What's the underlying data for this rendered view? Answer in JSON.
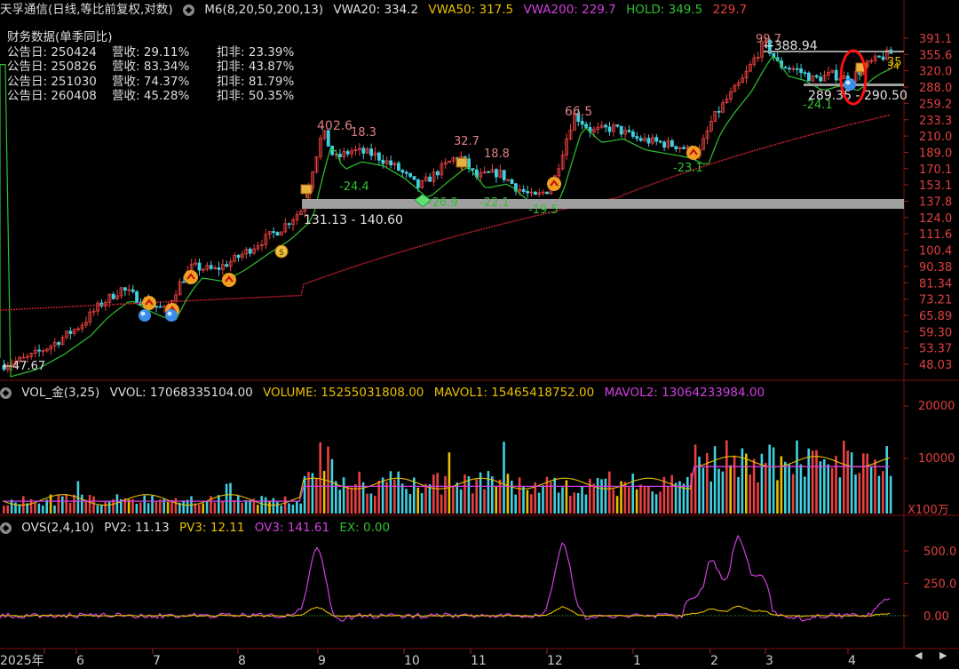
{
  "header": {
    "stock": "天孚通信(日线,等比前复权,对数)",
    "m6": "M6(8,20,50,200,13)",
    "vwa20": "VWA20: 334.2",
    "vwa50": "VWA50: 317.5",
    "vwa200": "VWA200: 229.7",
    "hold": "HOLD: 349.5",
    "hold2": "229.7"
  },
  "financials": {
    "title": "财务数据(单季同比)",
    "rows": [
      {
        "date": "公告日: 250424",
        "rev": "营收:  29.11%",
        "net": "扣非:  23.39%"
      },
      {
        "date": "公告日: 250826",
        "rev": "营收:  83.34%",
        "net": "扣非:  43.87%"
      },
      {
        "date": "公告日: 251030",
        "rev": "营收:  74.37%",
        "net": "扣非:  81.79%"
      },
      {
        "date": "公告日: 260408",
        "rev": "营收:  45.28%",
        "net": "扣非:  50.35%"
      }
    ]
  },
  "price_axis": [
    "391.1",
    "355.6",
    "320.0",
    "288.0",
    "259.2",
    "233.3",
    "210.0",
    "189.0",
    "170.1",
    "153.1",
    "137.8",
    "124.0",
    "111.6",
    "100.4",
    "90.38",
    "81.34",
    "73.21",
    "65.89",
    "59.30",
    "53.37",
    "48.03"
  ],
  "annotations": {
    "low_start": "47.67",
    "p402": "402.6",
    "p183": "18.3",
    "m244": "-24.4",
    "p327": "32.7",
    "p188": "18.8",
    "m269": "-26.9",
    "m221": "-22.1",
    "m195": "-19.5",
    "p665": "66.5",
    "m231": "-23.1",
    "p997": "99.7",
    "p38894": "388.94",
    "m241": "-24.1",
    "range1": "131.13 - 140.60",
    "range2": "289.35 - 290.50",
    "p35": "35",
    "p34": "34"
  },
  "vol_header": {
    "name": "VOL_金(3,25)",
    "vvol": "VVOL: 17068335104.00",
    "volume": "VOLUME: 15255031808.00",
    "mavol1": "MAVOL1: 15465418752.00",
    "mavol2": "MAVOL2: 13064233984.00"
  },
  "vol_axis": [
    "20000",
    "10000"
  ],
  "vol_unit": "X100万",
  "ovs_header": {
    "name": "OVS(2,4,10)",
    "pv2": "PV2: 11.13",
    "pv3": "PV3: 12.11",
    "ov3": "OV3: 141.61",
    "ex": "EX: 0.00"
  },
  "ovs_axis": [
    "500.0",
    "250.0",
    "0.00"
  ],
  "x_axis": [
    "2025年",
    "6",
    "7",
    "8",
    "9",
    "10",
    "11",
    "12",
    "1",
    "2",
    "3",
    "4"
  ],
  "colors": {
    "up": "#e84040",
    "down": "#40d0e0",
    "green": "#30c030",
    "yellow": "#e8c000",
    "magenta": "#d040e0",
    "white": "#e0e0e0"
  },
  "chart_data": {
    "type": "candlestick",
    "log_scale": true,
    "ylim": [
      48.03,
      391.1
    ],
    "approx_close": [
      47.67,
      52,
      58,
      63,
      70,
      76,
      78,
      72,
      80,
      88,
      95,
      92,
      100,
      110,
      131,
      180,
      230,
      210,
      195,
      185,
      175,
      165,
      150,
      170,
      190,
      178,
      160,
      150,
      140,
      150,
      170,
      230,
      225,
      215,
      205,
      200,
      185,
      195,
      240,
      300,
      330,
      360,
      395,
      350,
      320,
      300,
      290,
      310,
      330,
      350,
      355
    ]
  },
  "icons": [
    "option-icon",
    "money-bag-icon",
    "up-arrow-badge-icon",
    "blue-ball-icon",
    "diamond-icon",
    "flag-icon"
  ]
}
